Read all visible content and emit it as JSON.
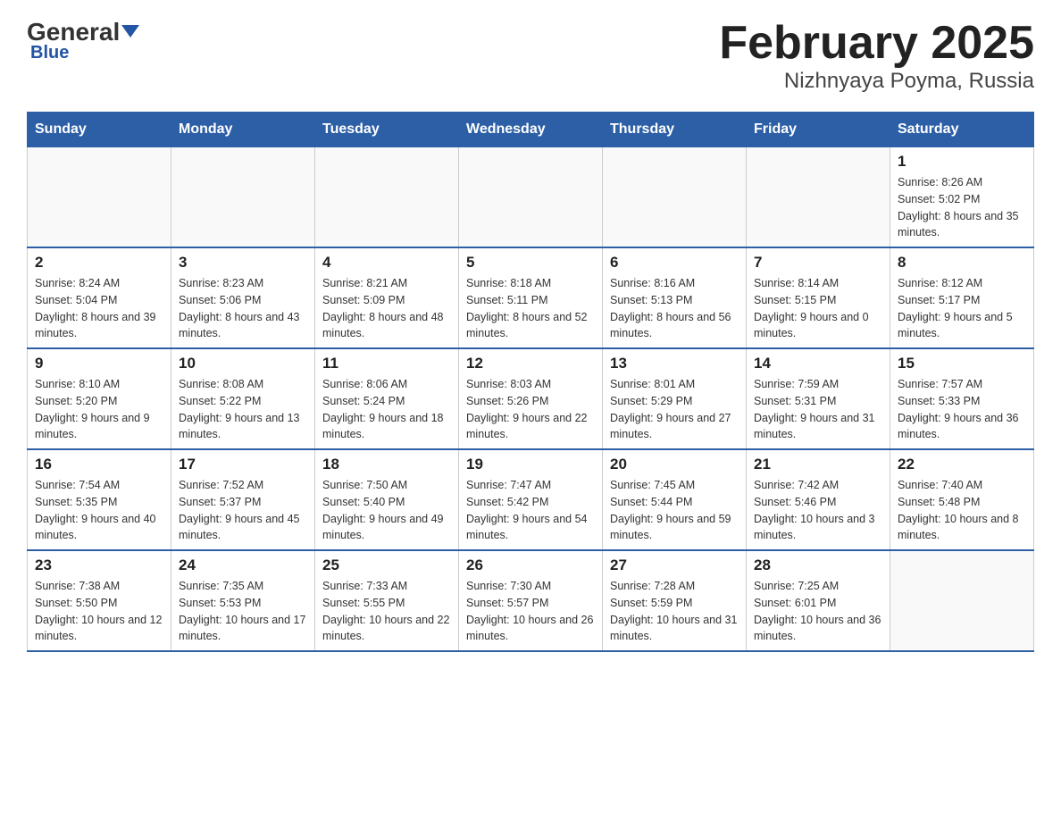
{
  "header": {
    "logo_general": "General",
    "logo_blue": "Blue",
    "title": "February 2025",
    "subtitle": "Nizhnyaya Poyma, Russia"
  },
  "weekdays": [
    "Sunday",
    "Monday",
    "Tuesday",
    "Wednesday",
    "Thursday",
    "Friday",
    "Saturday"
  ],
  "weeks": [
    [
      {
        "day": "",
        "info": ""
      },
      {
        "day": "",
        "info": ""
      },
      {
        "day": "",
        "info": ""
      },
      {
        "day": "",
        "info": ""
      },
      {
        "day": "",
        "info": ""
      },
      {
        "day": "",
        "info": ""
      },
      {
        "day": "1",
        "info": "Sunrise: 8:26 AM\nSunset: 5:02 PM\nDaylight: 8 hours and 35 minutes."
      }
    ],
    [
      {
        "day": "2",
        "info": "Sunrise: 8:24 AM\nSunset: 5:04 PM\nDaylight: 8 hours and 39 minutes."
      },
      {
        "day": "3",
        "info": "Sunrise: 8:23 AM\nSunset: 5:06 PM\nDaylight: 8 hours and 43 minutes."
      },
      {
        "day": "4",
        "info": "Sunrise: 8:21 AM\nSunset: 5:09 PM\nDaylight: 8 hours and 48 minutes."
      },
      {
        "day": "5",
        "info": "Sunrise: 8:18 AM\nSunset: 5:11 PM\nDaylight: 8 hours and 52 minutes."
      },
      {
        "day": "6",
        "info": "Sunrise: 8:16 AM\nSunset: 5:13 PM\nDaylight: 8 hours and 56 minutes."
      },
      {
        "day": "7",
        "info": "Sunrise: 8:14 AM\nSunset: 5:15 PM\nDaylight: 9 hours and 0 minutes."
      },
      {
        "day": "8",
        "info": "Sunrise: 8:12 AM\nSunset: 5:17 PM\nDaylight: 9 hours and 5 minutes."
      }
    ],
    [
      {
        "day": "9",
        "info": "Sunrise: 8:10 AM\nSunset: 5:20 PM\nDaylight: 9 hours and 9 minutes."
      },
      {
        "day": "10",
        "info": "Sunrise: 8:08 AM\nSunset: 5:22 PM\nDaylight: 9 hours and 13 minutes."
      },
      {
        "day": "11",
        "info": "Sunrise: 8:06 AM\nSunset: 5:24 PM\nDaylight: 9 hours and 18 minutes."
      },
      {
        "day": "12",
        "info": "Sunrise: 8:03 AM\nSunset: 5:26 PM\nDaylight: 9 hours and 22 minutes."
      },
      {
        "day": "13",
        "info": "Sunrise: 8:01 AM\nSunset: 5:29 PM\nDaylight: 9 hours and 27 minutes."
      },
      {
        "day": "14",
        "info": "Sunrise: 7:59 AM\nSunset: 5:31 PM\nDaylight: 9 hours and 31 minutes."
      },
      {
        "day": "15",
        "info": "Sunrise: 7:57 AM\nSunset: 5:33 PM\nDaylight: 9 hours and 36 minutes."
      }
    ],
    [
      {
        "day": "16",
        "info": "Sunrise: 7:54 AM\nSunset: 5:35 PM\nDaylight: 9 hours and 40 minutes."
      },
      {
        "day": "17",
        "info": "Sunrise: 7:52 AM\nSunset: 5:37 PM\nDaylight: 9 hours and 45 minutes."
      },
      {
        "day": "18",
        "info": "Sunrise: 7:50 AM\nSunset: 5:40 PM\nDaylight: 9 hours and 49 minutes."
      },
      {
        "day": "19",
        "info": "Sunrise: 7:47 AM\nSunset: 5:42 PM\nDaylight: 9 hours and 54 minutes."
      },
      {
        "day": "20",
        "info": "Sunrise: 7:45 AM\nSunset: 5:44 PM\nDaylight: 9 hours and 59 minutes."
      },
      {
        "day": "21",
        "info": "Sunrise: 7:42 AM\nSunset: 5:46 PM\nDaylight: 10 hours and 3 minutes."
      },
      {
        "day": "22",
        "info": "Sunrise: 7:40 AM\nSunset: 5:48 PM\nDaylight: 10 hours and 8 minutes."
      }
    ],
    [
      {
        "day": "23",
        "info": "Sunrise: 7:38 AM\nSunset: 5:50 PM\nDaylight: 10 hours and 12 minutes."
      },
      {
        "day": "24",
        "info": "Sunrise: 7:35 AM\nSunset: 5:53 PM\nDaylight: 10 hours and 17 minutes."
      },
      {
        "day": "25",
        "info": "Sunrise: 7:33 AM\nSunset: 5:55 PM\nDaylight: 10 hours and 22 minutes."
      },
      {
        "day": "26",
        "info": "Sunrise: 7:30 AM\nSunset: 5:57 PM\nDaylight: 10 hours and 26 minutes."
      },
      {
        "day": "27",
        "info": "Sunrise: 7:28 AM\nSunset: 5:59 PM\nDaylight: 10 hours and 31 minutes."
      },
      {
        "day": "28",
        "info": "Sunrise: 7:25 AM\nSunset: 6:01 PM\nDaylight: 10 hours and 36 minutes."
      },
      {
        "day": "",
        "info": ""
      }
    ]
  ]
}
